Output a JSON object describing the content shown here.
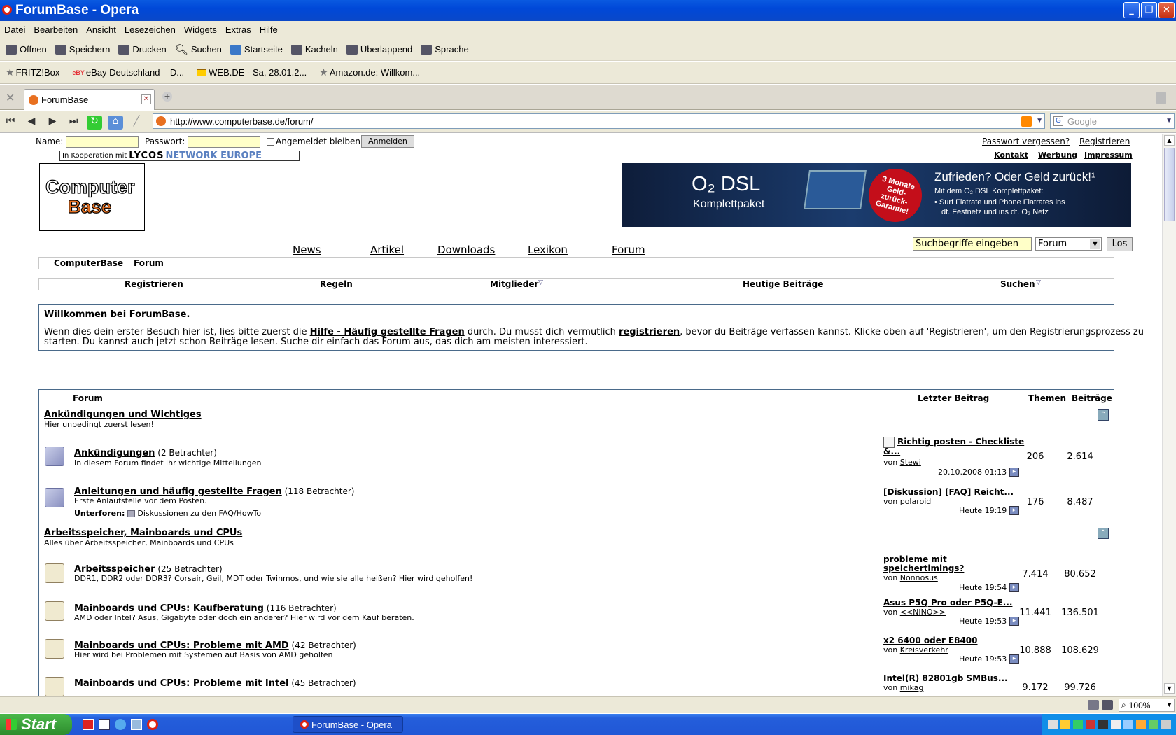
{
  "window": {
    "title": "ForumBase - Opera"
  },
  "menu": [
    "Datei",
    "Bearbeiten",
    "Ansicht",
    "Lesezeichen",
    "Widgets",
    "Extras",
    "Hilfe"
  ],
  "toolbar": [
    "Öffnen",
    "Speichern",
    "Drucken",
    "Suchen",
    "Startseite",
    "Kacheln",
    "Überlappend",
    "Sprache"
  ],
  "bookmarks": [
    "FRITZ!Box",
    "eBay Deutschland – D...",
    "WEB.DE - Sa, 28.01.2...",
    "Amazon.de: Willkom..."
  ],
  "tab": {
    "label": "ForumBase"
  },
  "address": {
    "url": "http://www.computerbase.de/forum/",
    "search_placeholder": "Google"
  },
  "login": {
    "name_label": "Name:",
    "password_label": "Passwort:",
    "remember": "Angemeldet bleiben",
    "submit": "Anmelden",
    "forgot": "Passwort vergessen?",
    "register": "Registrieren"
  },
  "header": {
    "coop_prefix": "In Kooperation mit",
    "coop_brand": "LYCOS",
    "coop_brand2": "NETWORK EUROPE",
    "links": [
      "Kontakt",
      "Werbung",
      "Impressum"
    ],
    "logo_line1": "Computer",
    "logo_line2": "Base"
  },
  "banner": {
    "product": "O₂ DSL",
    "product_sub": "Komplettpaket",
    "badge": "3 Monate Geld-zurück-Garantie!",
    "headline": "Zufrieden? Oder Geld zurück!¹",
    "sub": "Mit dem O₂ DSL Komplettpaket:",
    "b1": "• Surf Flatrate und Phone Flatrates ins",
    "b2": "dt. Festnetz und ins dt. O₂ Netz"
  },
  "mainnav": [
    "News",
    "Artikel",
    "Downloads",
    "Lexikon",
    "Forum"
  ],
  "search": {
    "placeholder": "Suchbegriffe eingeben",
    "scope": "Forum",
    "button": "Los"
  },
  "breadcrumb": [
    "ComputerBase",
    "Forum"
  ],
  "subnav": [
    "Registrieren",
    "Regeln",
    "Mitglieder",
    "Heutige Beiträge",
    "Suchen"
  ],
  "welcome": {
    "title": "Willkommen bei ForumBase.",
    "t1": "Wenn dies dein erster Besuch hier ist, lies bitte zuerst die ",
    "l1": "Hilfe - Häufig gestellte Fragen",
    "t2": " durch. Du musst dich vermutlich ",
    "l2": "registrieren",
    "t3": ", bevor du Beiträge verfassen kannst. Klicke oben auf 'Registrieren', um den Registrierungsprozess zu",
    "t4": "starten. Du kannst auch jetzt schon Beiträge lesen. Suche dir einfach das Forum aus, das dich am meisten interessiert."
  },
  "forum": {
    "col_forum": "Forum",
    "col_last": "Letzter Beitrag",
    "col_threads": "Themen",
    "col_posts": "Beiträge",
    "cat1": {
      "title": "Ankündigungen und Wichtiges",
      "desc": "Hier unbedingt zuerst lesen!"
    },
    "cat2": {
      "title": "Arbeitsspeicher, Mainboards und CPUs",
      "desc": "Alles über Arbeitsspeicher, Mainboards und CPUs"
    },
    "f1": {
      "name": "Ankündigungen",
      "viewers": "(2 Betrachter)",
      "desc": "In diesem Forum findet ihr wichtige Mitteilungen",
      "last": "Richtig posten - Checkliste",
      "last2": "&...",
      "by": "von",
      "user": "Stewi",
      "time": "20.10.2008 01:13",
      "threads": "206",
      "posts": "2.614"
    },
    "f2": {
      "name": "Anleitungen und häufig gestellte Fragen",
      "viewers": "(118 Betrachter)",
      "desc": "Erste Anlaufstelle vor dem Posten.",
      "sub_label": "Unterforen:",
      "sub": "Diskussionen zu den FAQ/HowTo",
      "last": "[Diskussion] [FAQ] Reicht...",
      "by": "von",
      "user": "polaroid",
      "time": "Heute 19:19",
      "threads": "176",
      "posts": "8.487"
    },
    "f3": {
      "name": "Arbeitsspeicher",
      "viewers": "(25 Betrachter)",
      "desc": "DDR1, DDR2 oder DDR3? Corsair, Geil, MDT oder Twinmos, und wie sie alle heißen? Hier wird geholfen!",
      "last": "probleme mit",
      "last2": "speichertimings?",
      "by": "von",
      "user": "Nonnosus",
      "time": "Heute 19:54",
      "threads": "7.414",
      "posts": "80.652"
    },
    "f4": {
      "name": "Mainboards und CPUs: Kaufberatung",
      "viewers": "(116 Betrachter)",
      "desc": "AMD oder Intel? Asus, Gigabyte oder doch ein anderer? Hier wird vor dem Kauf beraten.",
      "last": "Asus P5Q Pro oder P5Q-E...",
      "by": "von",
      "user": "<<NINO>>",
      "time": "Heute 19:53",
      "threads": "11.441",
      "posts": "136.501"
    },
    "f5": {
      "name": "Mainboards und CPUs: Probleme mit AMD",
      "viewers": "(42 Betrachter)",
      "desc": "Hier wird bei Problemen mit Systemen auf Basis von AMD geholfen",
      "last": "x2 6400 oder E8400",
      "by": "von",
      "user": "Kreisverkehr",
      "time": "Heute 19:53",
      "threads": "10.888",
      "posts": "108.629"
    },
    "f6": {
      "name": "Mainboards und CPUs: Probleme mit Intel",
      "viewers": "(45 Betrachter)",
      "last": "Intel(R) 82801gb SMBus...",
      "by": "von",
      "user": "mikag",
      "threads": "9.172",
      "posts": "99.726"
    }
  },
  "status": {
    "zoom": "100%"
  },
  "taskbar": {
    "start": "Start",
    "item": "ForumBase - Opera"
  }
}
